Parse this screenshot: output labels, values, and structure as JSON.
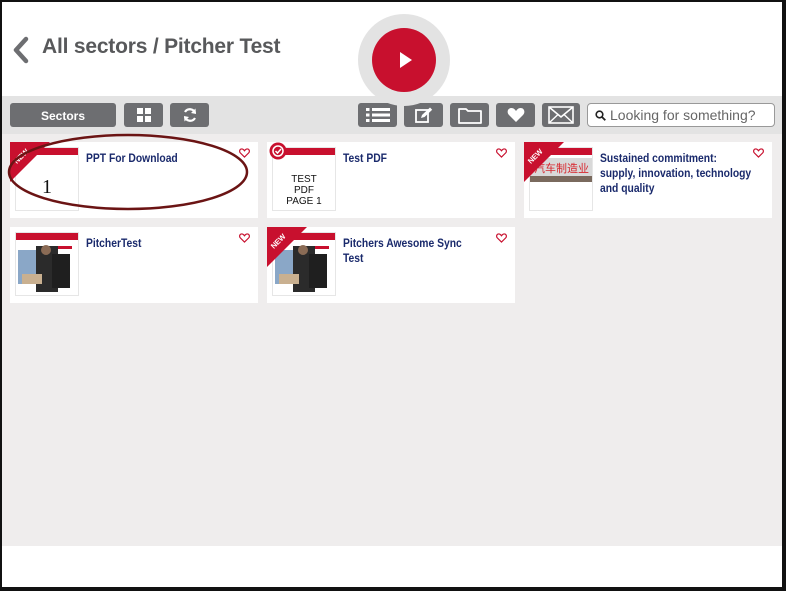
{
  "header": {
    "breadcrumb": "All sectors / Pitcher Test",
    "accent_color": "#c8102e"
  },
  "toolbar": {
    "sectors_label": "Sectors",
    "search_placeholder": "Looking for something?",
    "icons": [
      "grid-icon",
      "refresh-icon",
      "list-icon",
      "edit-icon",
      "folder-icon",
      "heart-icon",
      "mail-icon",
      "search-icon"
    ]
  },
  "files": [
    {
      "title": "PPT For Download",
      "badge": "NEW",
      "thumb_text": "1",
      "thumb_kind": "page-number",
      "favorite": false
    },
    {
      "title": "Test PDF",
      "badge": "status",
      "thumb_text": "TEST PDF PAGE 1",
      "thumb_kind": "text",
      "favorite": false
    },
    {
      "title": "Sustained commitment: supply, innovation, technology and quality",
      "badge": "NEW",
      "thumb_text": "汽车制造业",
      "thumb_kind": "image",
      "favorite": false
    },
    {
      "title": "PitcherTest",
      "badge": "",
      "thumb_kind": "image",
      "favorite": false
    },
    {
      "title": "Pitchers Awesome Sync Test",
      "badge": "NEW",
      "thumb_kind": "image",
      "favorite": false
    }
  ]
}
